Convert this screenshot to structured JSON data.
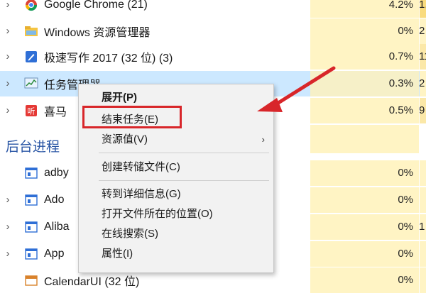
{
  "processes": [
    {
      "name": "Google Chrome (21)",
      "cpu": "4.2%",
      "mem": "1,",
      "icon": "chrome-icon",
      "expanded": false,
      "selected": false
    },
    {
      "name": "Windows 资源管理器",
      "cpu": "0%",
      "mem": "2",
      "icon": "explorer-folder-icon"
    },
    {
      "name": "极速写作 2017 (32 位) (3)",
      "cpu": "0.7%",
      "mem": "11",
      "icon": "writer-app-icon"
    },
    {
      "name": "任务管理器",
      "cpu": "0.3%",
      "mem": "2",
      "icon": "task-manager-icon",
      "selected": true
    },
    {
      "name": "喜马",
      "cpu": "0.5%",
      "mem": "9",
      "icon": "ximalaya-icon"
    }
  ],
  "background_section_title": "后台进程",
  "background_processes": [
    {
      "name": "adby",
      "cpu": "0%",
      "mem": ""
    },
    {
      "name": "Ado",
      "cpu": "0%",
      "mem": ""
    },
    {
      "name": "Aliba",
      "cpu": "0%",
      "mem": "1"
    },
    {
      "name": "App",
      "cpu": "0%",
      "mem": ""
    },
    {
      "name": "CalendarUI (32 位)",
      "cpu": "0%",
      "mem": ""
    }
  ],
  "context_menu": {
    "expand": "展开(P)",
    "end_task": "结束任务(E)",
    "resource_values": "资源值(V)",
    "create_dump": "创建转储文件(C)",
    "go_to_details": "转到详细信息(G)",
    "open_file_location": "打开文件所在的位置(O)",
    "search_online": "在线搜索(S)",
    "properties": "属性(I)"
  },
  "colors": {
    "selected_row": "#cce8ff",
    "cpu_column": "#fff4c4",
    "annotation_red": "#d8262a",
    "section_title": "#2a56a5"
  }
}
